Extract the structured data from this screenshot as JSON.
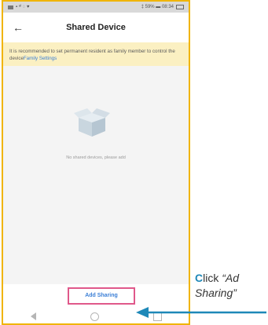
{
  "status_bar": {
    "left": "▪ ᵃᴵ ◌ ♥",
    "right": "‡ 59% ▬ 08:34"
  },
  "header": {
    "title": "Shared Device",
    "back_icon": "arrow-left-icon"
  },
  "banner": {
    "text": "It is recommended to set permanent resident as family member to control the device",
    "link": "Family Settings"
  },
  "empty_state": {
    "icon": "open-box-icon",
    "text": "No shared devices, please add"
  },
  "primary_button": {
    "label": "Add Sharing"
  },
  "nav_bar": [
    "back-triangle-icon",
    "home-circle-icon",
    "recents-square-icon"
  ],
  "annotation": {
    "first_letter": "C",
    "rest": "lick ",
    "quoted": "“Ad Sharing”"
  },
  "colors": {
    "accent": "#3b7fd6",
    "highlight": "#e0588a",
    "banner_bg": "#fbf0c2",
    "arrow": "#1e88b8",
    "frame": "#f0b400"
  }
}
